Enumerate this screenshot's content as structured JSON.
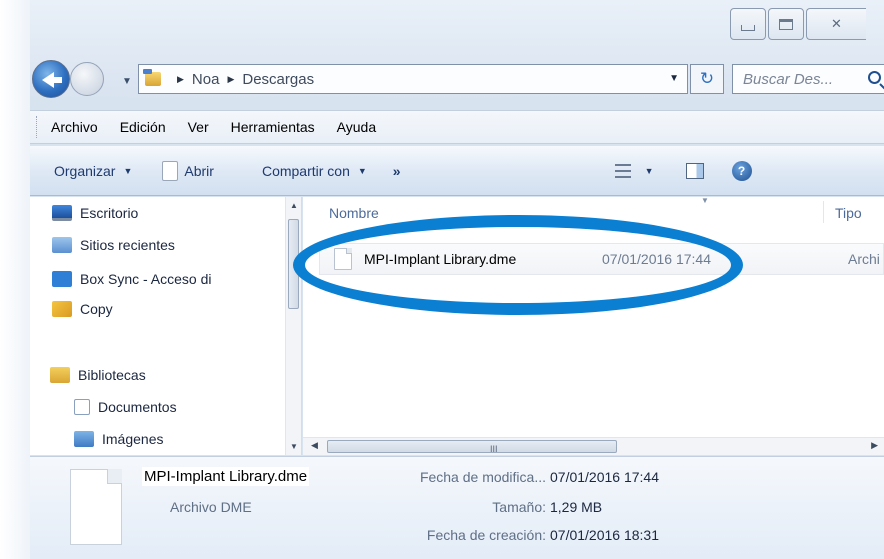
{
  "navigation": {
    "address": {
      "crumbs": [
        "Noa",
        "Descargas"
      ]
    },
    "search": {
      "placeholder": "Buscar Des..."
    }
  },
  "menu": [
    "Archivo",
    "Edición",
    "Ver",
    "Herramientas",
    "Ayuda"
  ],
  "commands": {
    "organize": "Organizar",
    "open": "Abrir",
    "share": "Compartir con",
    "more": "»"
  },
  "nav_pane": {
    "items": [
      "Escritorio",
      "Sitios recientes",
      "Box Sync - Acceso di",
      "Copy",
      "Bibliotecas",
      "Documentos",
      "Imágenes"
    ]
  },
  "file_list": {
    "columns": {
      "name": "Nombre",
      "type": "Tipo"
    },
    "files": [
      {
        "name": "MPI-Implant Library.dme",
        "date": "07/01/2016 17:44",
        "type": "Archi"
      }
    ],
    "hscroll_grip": "III"
  },
  "details": {
    "name": "MPI-Implant Library.dme",
    "type": "Archivo DME",
    "modified_label": "Fecha de modifica...",
    "modified_value": "07/01/2016 17:44",
    "size_label": "Tamaño:",
    "size_value": "1,29 MB",
    "created_label": "Fecha de creación:",
    "created_value": "07/01/2016 18:31"
  },
  "colors": {
    "highlight": "#0b7fd2",
    "link_text": "#1e3a6e"
  }
}
